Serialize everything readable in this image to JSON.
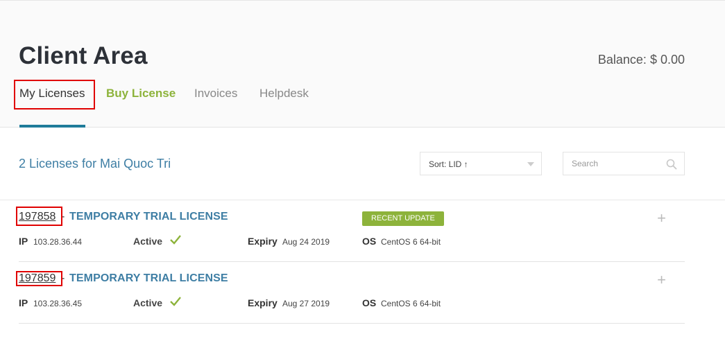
{
  "header": {
    "title": "Client Area",
    "balance_label": "Balance:",
    "balance_value": "$ 0.00"
  },
  "tabs": [
    {
      "label": "My Licenses",
      "active": true
    },
    {
      "label": "Buy License",
      "active": false
    },
    {
      "label": "Invoices",
      "active": false
    },
    {
      "label": "Helpdesk",
      "active": false
    }
  ],
  "toolbar": {
    "title": "2 Licenses for Mai Quoc Tri",
    "sort_label": "Sort: LID ↑",
    "search_placeholder": "Search"
  },
  "licenses": [
    {
      "id": "197858",
      "separator": "-",
      "name": "TEMPORARY TRIAL LICENSE",
      "badge": "RECENT UPDATE",
      "ip_label": "IP",
      "ip": "103.28.36.44",
      "status": "Active",
      "expiry_label": "Expiry",
      "expiry": "Aug 24 2019",
      "os_label": "OS",
      "os": "CentOS 6 64-bit",
      "expand": "+"
    },
    {
      "id": "197859",
      "separator": "-",
      "name": "TEMPORARY TRIAL LICENSE",
      "ip_label": "IP",
      "ip": "103.28.36.45",
      "status": "Active",
      "expiry_label": "Expiry",
      "expiry": "Aug 27 2019",
      "os_label": "OS",
      "os": "CentOS 6 64-bit",
      "expand": "+"
    }
  ],
  "colors": {
    "accent_green": "#8db33b",
    "accent_blue": "#3e7ea4",
    "tab_underline": "#1f7c9a",
    "highlight_red": "#e00000"
  }
}
